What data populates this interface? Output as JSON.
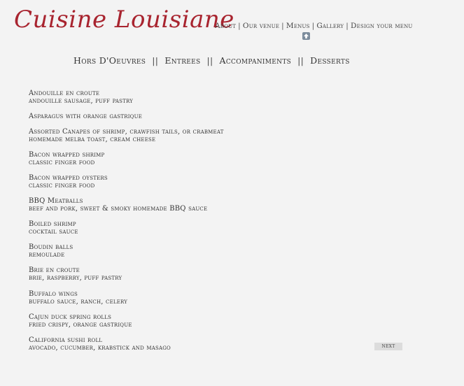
{
  "logo": {
    "text": "Cuisine Louisiane"
  },
  "topnav": {
    "items": [
      "About",
      "Our venue",
      "Menus",
      "Gallery",
      "Design your menu"
    ]
  },
  "icons": {
    "scroll_top": "up-arrow-icon"
  },
  "catnav": {
    "items": [
      "Hors D'Oeuvres",
      "Entrees",
      "Accompaniments",
      "Desserts"
    ]
  },
  "menu": {
    "items": [
      {
        "name": "Andouille en croute",
        "desc": "andouille sausage, puff pastry"
      },
      {
        "name": "Asparagus with orange gastrique",
        "desc": ""
      },
      {
        "name": "Assorted Canapes of shrimp, crawfish tails, or crabmeat",
        "desc": "homemade melba toast, cream cheese"
      },
      {
        "name": "Bacon wrapped shrimp",
        "desc": "classic finger food"
      },
      {
        "name": "Bacon wrapped oysters",
        "desc": "classic finger food"
      },
      {
        "name": "BBQ Meatballs",
        "desc": "beef and pork, sweet & smoky homemade BBQ sauce"
      },
      {
        "name": "Boiled shrimp",
        "desc": "cocktail sauce"
      },
      {
        "name": "Boudin balls",
        "desc": "remoulade"
      },
      {
        "name": "Brie en croute",
        "desc": "brie, raspberry, puff pastry"
      },
      {
        "name": "Buffalo wings",
        "desc": "buffalo sauce, ranch, celery"
      },
      {
        "name": "Cajun duck spring rolls",
        "desc": "fried crispy, orange gastrique"
      },
      {
        "name": "California sushi roll",
        "desc": "avocado, cucumber, krabstick and masago"
      }
    ]
  },
  "pager": {
    "next_label": "next"
  }
}
